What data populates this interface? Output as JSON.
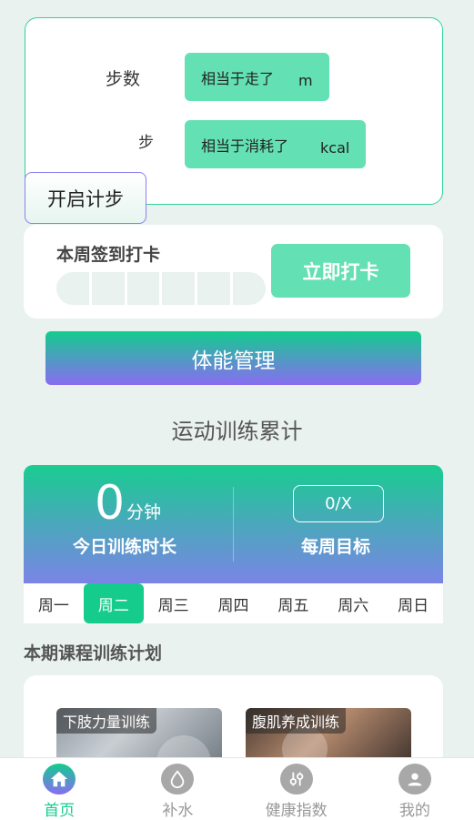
{
  "step_card": {
    "steps_label": "步数",
    "steps_unit": "步",
    "walk_text": "相当于走了",
    "walk_unit": "m",
    "burn_text": "相当于消耗了",
    "burn_unit": "kcal",
    "start_button": "开启计步"
  },
  "checkin": {
    "title": "本周签到打卡",
    "button": "立即打卡",
    "days_checked": 0,
    "segments": 6
  },
  "fitness_button": "体能管理",
  "section_title": "运动训练累计",
  "stats": {
    "today_value": "0",
    "today_unit": "分钟",
    "today_label": "今日训练时长",
    "weekly_goal_value": "0/X",
    "weekly_goal_label": "每周目标"
  },
  "week": {
    "days": [
      "周一",
      "周二",
      "周三",
      "周四",
      "周五",
      "周六",
      "周日"
    ],
    "active_index": 1
  },
  "plan": {
    "title": "本期课程训练计划",
    "courses": [
      {
        "name": "下肢力量训练"
      },
      {
        "name": "腹肌养成训练"
      }
    ]
  },
  "nav": {
    "items": [
      {
        "label": "首页",
        "icon": "home-icon"
      },
      {
        "label": "补水",
        "icon": "water-drop-icon"
      },
      {
        "label": "健康指数",
        "icon": "sliders-icon"
      },
      {
        "label": "我的",
        "icon": "user-icon"
      }
    ],
    "active_index": 0
  },
  "colors": {
    "accent": "#16cc8c",
    "pill": "#63e0b4",
    "gradient_end": "#8a6cf2"
  }
}
